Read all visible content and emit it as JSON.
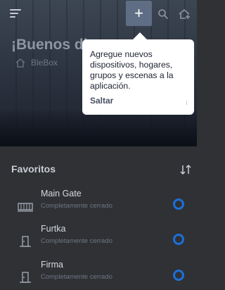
{
  "header": {
    "add_label": "+",
    "greeting": "¡Buenos di",
    "place_name": "BleBox"
  },
  "tooltip": {
    "message": "Agregue nuevos dispositivos, hogares, grupos y escenas a la aplicación.",
    "skip_label": "Saltar"
  },
  "favorites": {
    "title": "Favoritos",
    "items": [
      {
        "name": "Main Gate",
        "status": "Completamente cerrado",
        "icon": "gate-icon"
      },
      {
        "name": "Furtka",
        "status": "Completamente cerrado",
        "icon": "door-icon"
      },
      {
        "name": "Firma",
        "status": "Completamente cerrado",
        "icon": "door-icon"
      }
    ]
  },
  "colors": {
    "accent": "#1e6fd8",
    "background": "#2f3135",
    "add_button": "#5f6e84"
  }
}
